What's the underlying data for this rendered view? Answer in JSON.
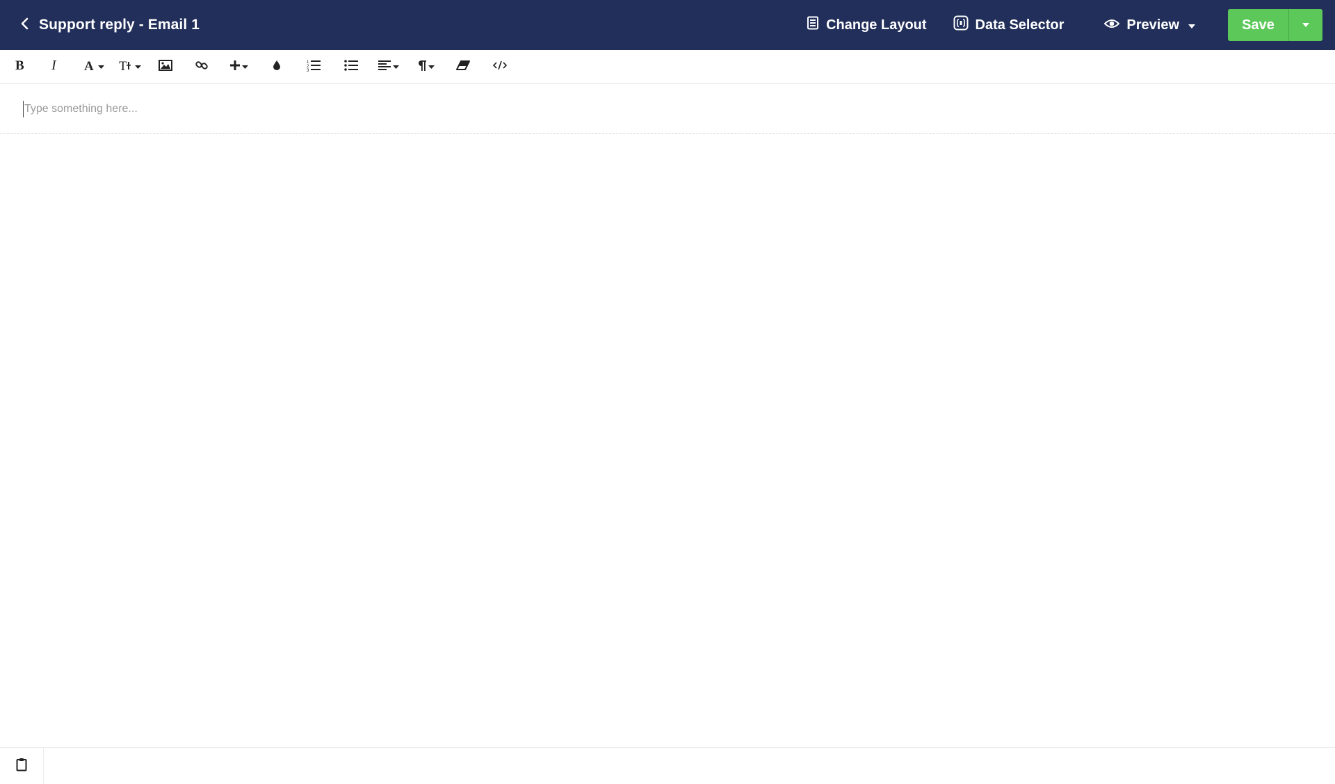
{
  "header": {
    "title": "Support reply - Email 1",
    "back_icon": "chevron-left-icon",
    "actions": {
      "change_layout": "Change Layout",
      "data_selector": "Data Selector",
      "preview": "Preview",
      "save": "Save"
    },
    "colors": {
      "bar": "#222f5a",
      "save": "#5cc85a"
    }
  },
  "toolbar": {
    "buttons": [
      {
        "name": "bold",
        "icon": "bold-icon"
      },
      {
        "name": "italic",
        "icon": "italic-icon"
      },
      {
        "name": "font-family",
        "icon": "font-icon"
      },
      {
        "name": "font-size",
        "icon": "text-size-icon"
      },
      {
        "name": "insert-image",
        "icon": "image-icon"
      },
      {
        "name": "insert-link",
        "icon": "link-icon"
      },
      {
        "name": "insert-more",
        "icon": "plus-icon"
      },
      {
        "name": "text-color",
        "icon": "color-drop-icon"
      },
      {
        "name": "ordered-list",
        "icon": "ordered-list-icon"
      },
      {
        "name": "unordered-list",
        "icon": "bullet-list-icon"
      },
      {
        "name": "align",
        "icon": "align-left-icon"
      },
      {
        "name": "paragraph-format",
        "icon": "paragraph-icon"
      },
      {
        "name": "clear-formatting",
        "icon": "eraser-icon"
      },
      {
        "name": "code-view",
        "icon": "code-icon"
      }
    ]
  },
  "editor": {
    "placeholder": "Type something here..."
  },
  "footer": {
    "icon": "clipboard-icon"
  }
}
